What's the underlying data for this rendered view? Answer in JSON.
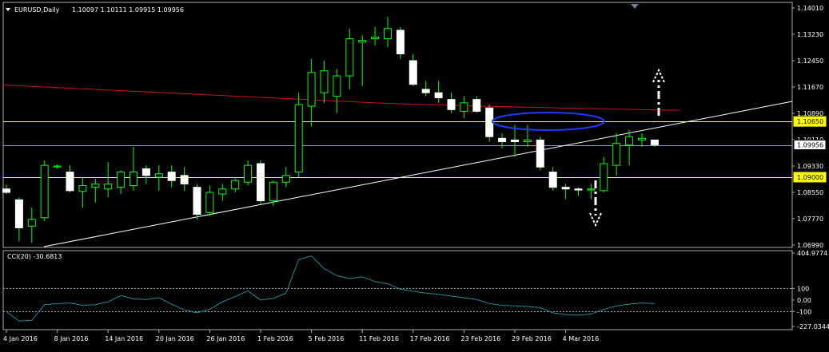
{
  "chart_data": {
    "type": "candlestick",
    "symbol_header": "EURUSD,Daily",
    "ohlc_header": "1.10097 1.10111 1.09915 1.09956",
    "price_axis_ticks": [
      "1.14010",
      "1.13230",
      "1.12450",
      "1.11670",
      "1.10890",
      "1.10110",
      "1.09330",
      "1.08550",
      "1.07770",
      "1.06990"
    ],
    "price_range": [
      1.0699,
      1.1401
    ],
    "price_labels": [
      {
        "text": "1.10650",
        "value": 1.1065,
        "style": "yellow"
      },
      {
        "text": "1.09956",
        "value": 1.09956,
        "style": "white"
      },
      {
        "text": "1.09000",
        "value": 1.09,
        "style": "yellow"
      }
    ],
    "horizontal_lines": [
      {
        "value": 1.1065,
        "color": "#ffff80"
      },
      {
        "value": 1.09956,
        "color": "#8ba0c8"
      },
      {
        "value": 1.09,
        "color": "#ffff80"
      }
    ],
    "date_labels": [
      "4 Jan 2016",
      "8 Jan 2016",
      "14 Jan 2016",
      "20 Jan 2016",
      "26 Jan 2016",
      "1 Feb 2016",
      "5 Feb 2016",
      "11 Feb 2016",
      "17 Feb 2016",
      "23 Feb 2016",
      "29 Feb 2016",
      "4 Mar 2016"
    ],
    "date_label_bars": [
      0,
      4,
      8,
      12,
      16,
      20,
      24,
      28,
      32,
      36,
      40,
      44
    ],
    "candles": [
      {
        "o": 1.0865,
        "h": 1.0878,
        "l": 1.085,
        "c": 1.0855
      },
      {
        "o": 1.0833,
        "h": 1.084,
        "l": 1.071,
        "c": 1.075
      },
      {
        "o": 1.0755,
        "h": 1.081,
        "l": 1.0705,
        "c": 1.0775
      },
      {
        "o": 1.078,
        "h": 1.095,
        "l": 1.077,
        "c": 1.0935
      },
      {
        "o": 1.093,
        "h": 1.0938,
        "l": 1.0925,
        "c": 1.0933
      },
      {
        "o": 1.0915,
        "h": 1.0935,
        "l": 1.0855,
        "c": 1.086
      },
      {
        "o": 1.0858,
        "h": 1.09,
        "l": 1.081,
        "c": 1.0875
      },
      {
        "o": 1.087,
        "h": 1.0895,
        "l": 1.0825,
        "c": 1.088
      },
      {
        "o": 1.0865,
        "h": 1.0945,
        "l": 1.084,
        "c": 1.088
      },
      {
        "o": 1.087,
        "h": 1.092,
        "l": 1.085,
        "c": 1.0915
      },
      {
        "o": 1.0875,
        "h": 1.099,
        "l": 1.086,
        "c": 1.0915
      },
      {
        "o": 1.0925,
        "h": 1.0935,
        "l": 1.088,
        "c": 1.0905
      },
      {
        "o": 1.09,
        "h": 1.0935,
        "l": 1.086,
        "c": 1.091
      },
      {
        "o": 1.0915,
        "h": 1.0935,
        "l": 1.087,
        "c": 1.089
      },
      {
        "o": 1.0905,
        "h": 1.093,
        "l": 1.086,
        "c": 1.088
      },
      {
        "o": 1.087,
        "h": 1.088,
        "l": 1.0775,
        "c": 1.079
      },
      {
        "o": 1.0795,
        "h": 1.0875,
        "l": 1.0785,
        "c": 1.0855
      },
      {
        "o": 1.085,
        "h": 1.088,
        "l": 1.083,
        "c": 1.0865
      },
      {
        "o": 1.0865,
        "h": 1.09,
        "l": 1.0855,
        "c": 1.089
      },
      {
        "o": 1.0885,
        "h": 1.095,
        "l": 1.0875,
        "c": 1.0935
      },
      {
        "o": 1.094,
        "h": 1.095,
        "l": 1.082,
        "c": 1.083
      },
      {
        "o": 1.083,
        "h": 1.089,
        "l": 1.0815,
        "c": 1.0885
      },
      {
        "o": 1.0885,
        "h": 1.093,
        "l": 1.087,
        "c": 1.0905
      },
      {
        "o": 1.0915,
        "h": 1.115,
        "l": 1.09,
        "c": 1.1115
      },
      {
        "o": 1.111,
        "h": 1.125,
        "l": 1.105,
        "c": 1.121
      },
      {
        "o": 1.115,
        "h": 1.1245,
        "l": 1.112,
        "c": 1.1215
      },
      {
        "o": 1.114,
        "h": 1.122,
        "l": 1.109,
        "c": 1.12
      },
      {
        "o": 1.12,
        "h": 1.134,
        "l": 1.116,
        "c": 1.131
      },
      {
        "o": 1.13,
        "h": 1.132,
        "l": 1.117,
        "c": 1.1305
      },
      {
        "o": 1.131,
        "h": 1.1345,
        "l": 1.129,
        "c": 1.1315
      },
      {
        "o": 1.131,
        "h": 1.1375,
        "l": 1.1285,
        "c": 1.134
      },
      {
        "o": 1.1335,
        "h": 1.1345,
        "l": 1.125,
        "c": 1.1265
      },
      {
        "o": 1.1245,
        "h": 1.1265,
        "l": 1.117,
        "c": 1.1175
      },
      {
        "o": 1.116,
        "h": 1.1185,
        "l": 1.114,
        "c": 1.115
      },
      {
        "o": 1.115,
        "h": 1.1185,
        "l": 1.112,
        "c": 1.1135
      },
      {
        "o": 1.113,
        "h": 1.115,
        "l": 1.109,
        "c": 1.11
      },
      {
        "o": 1.1095,
        "h": 1.114,
        "l": 1.1075,
        "c": 1.112
      },
      {
        "o": 1.113,
        "h": 1.114,
        "l": 1.109,
        "c": 1.1095
      },
      {
        "o": 1.1105,
        "h": 1.1115,
        "l": 1.1005,
        "c": 1.102
      },
      {
        "o": 1.1015,
        "h": 1.103,
        "l": 1.0985,
        "c": 1.1005
      },
      {
        "o": 1.101,
        "h": 1.1055,
        "l": 1.096,
        "c": 1.1005
      },
      {
        "o": 1.1005,
        "h": 1.1055,
        "l": 1.099,
        "c": 1.101
      },
      {
        "o": 1.101,
        "h": 1.102,
        "l": 1.092,
        "c": 1.093
      },
      {
        "o": 1.0915,
        "h": 1.093,
        "l": 1.086,
        "c": 1.087
      },
      {
        "o": 1.087,
        "h": 1.088,
        "l": 1.0835,
        "c": 1.0865
      },
      {
        "o": 1.0865,
        "h": 1.087,
        "l": 1.0845,
        "c": 1.0862
      },
      {
        "o": 1.0862,
        "h": 1.088,
        "l": 1.0835,
        "c": 1.0865
      },
      {
        "o": 1.086,
        "h": 1.096,
        "l": 1.0855,
        "c": 1.094
      },
      {
        "o": 1.0935,
        "h": 1.103,
        "l": 1.0905,
        "c": 1.1
      },
      {
        "o": 1.0995,
        "h": 1.104,
        "l": 1.0935,
        "c": 1.102
      },
      {
        "o": 1.101,
        "h": 1.103,
        "l": 1.099,
        "c": 1.1015
      },
      {
        "o": 1.101,
        "h": 1.101,
        "l": 1.099,
        "c": 1.0996
      }
    ],
    "moving_average": {
      "start": 1.1173,
      "end": 1.1098,
      "color": "#c81414"
    },
    "trendline": {
      "color": "#ffffff"
    },
    "ellipse": {
      "color": "#1e3cff"
    },
    "arrows": [
      {
        "direction": "up",
        "color": "#ffffff"
      },
      {
        "direction": "down",
        "color": "#ffffff"
      }
    ],
    "cci": {
      "label": "CCI(20) -30.6813",
      "axis_ticks": [
        "404.9774",
        "100",
        "0.00",
        "-100",
        "-227.0344"
      ],
      "range": [
        -227.0344,
        404.9774
      ],
      "levels": [
        100,
        -100
      ],
      "color": "#1e8c9a",
      "values": [
        -100,
        -180,
        -175,
        -40,
        -30,
        -25,
        -45,
        -40,
        -15,
        40,
        10,
        5,
        20,
        -35,
        -85,
        -110,
        -80,
        -15,
        30,
        80,
        0,
        15,
        60,
        350,
        380,
        270,
        210,
        185,
        200,
        160,
        140,
        95,
        75,
        60,
        50,
        35,
        20,
        5,
        -30,
        -45,
        -50,
        -55,
        -65,
        -110,
        -125,
        -130,
        -120,
        -80,
        -50,
        -35,
        -25,
        -30
      ]
    },
    "top_marker_color": "#6a7f99"
  }
}
